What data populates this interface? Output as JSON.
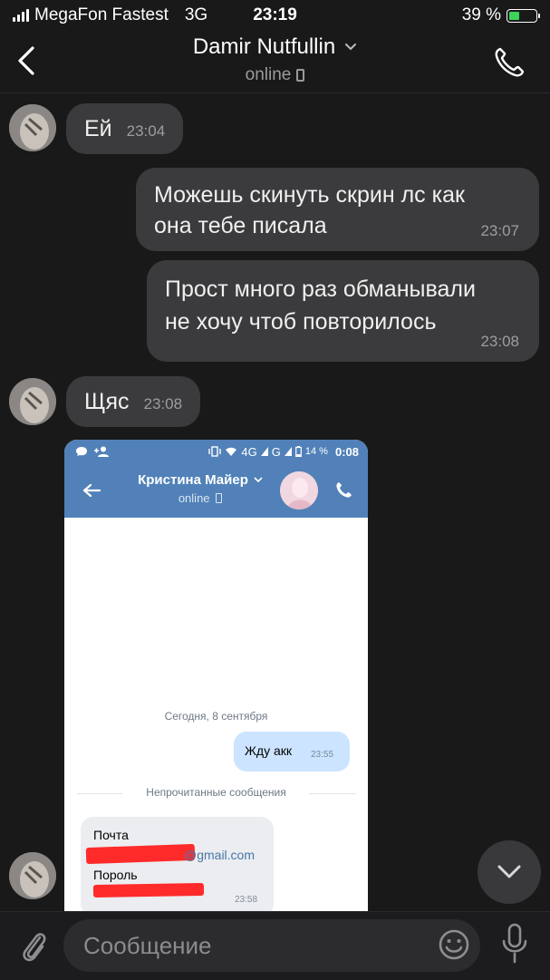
{
  "status": {
    "carrier": "MegaFon Fastest",
    "network": "3G",
    "time": "23:19",
    "battery": "39 %",
    "battery_level": 0.39,
    "battery_color": "#3cd35b"
  },
  "header": {
    "contact_name": "Damir Nutfullin",
    "status": "online",
    "icons": [
      "back-icon",
      "chevron-down-icon",
      "mobile-icon",
      "phone-icon"
    ]
  },
  "messages": [
    {
      "direction": "in",
      "text": "Ей",
      "time": "23:04"
    },
    {
      "direction": "out",
      "lines": [
        "Можешь скинуть скрин лс  как",
        "она тебе писала"
      ],
      "time": "23:07"
    },
    {
      "direction": "out",
      "lines": [
        "Прост много раз обманывали",
        "не хочу чтоб повторилось"
      ],
      "time": "23:08"
    },
    {
      "direction": "in",
      "text": "Щяс",
      "time": "23:08"
    }
  ],
  "embedded_screenshot": {
    "status": {
      "network": "4G",
      "network2": "G",
      "battery": "14 %",
      "time": "0:08"
    },
    "contact_name": "Кристина Майер",
    "contact_status": "online",
    "date_separator": "Сегодня, 8 сентября",
    "outgoing": {
      "text": "Жду акк",
      "time": "23:55"
    },
    "unread_divider": "Непрочитанные сообщения",
    "incoming": {
      "line1": "Почта",
      "email_visible": "@gmail.com",
      "line3": "Пороль",
      "time": "23:58"
    },
    "accent_color": "#5181b8"
  },
  "input": {
    "placeholder": "Сообщение",
    "icons": [
      "attach-icon",
      "emoji-icon",
      "microphone-icon"
    ]
  }
}
